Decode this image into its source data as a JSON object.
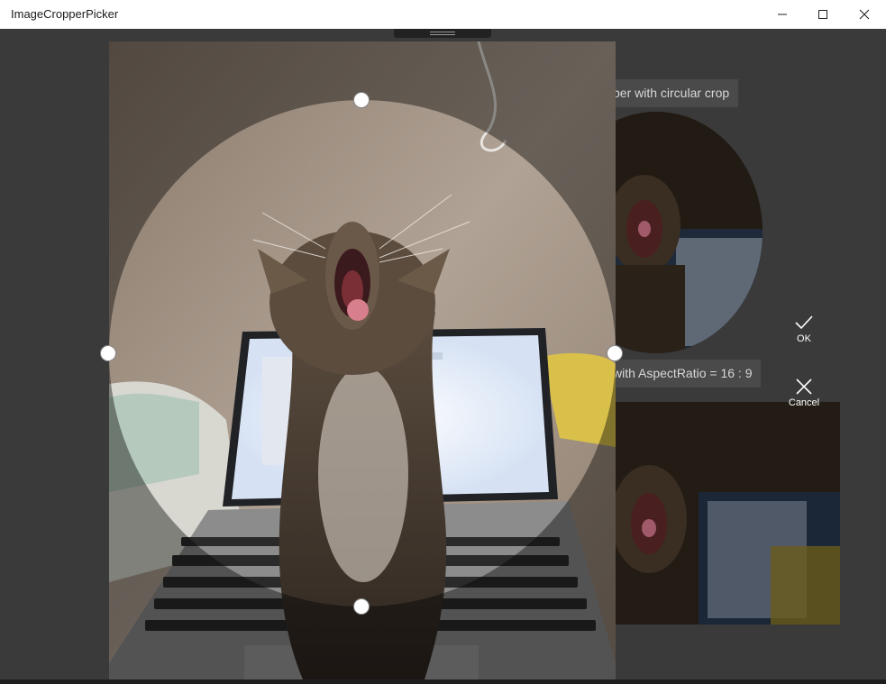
{
  "window": {
    "title": "ImageCropperPicker",
    "minimize_label": "minimize",
    "maximize_label": "maximize",
    "close_label": "close"
  },
  "background": {
    "circular_label": "per with circular crop",
    "aspect_label": "with AspectRatio = 16 : 9"
  },
  "actions": {
    "ok_label": "OK",
    "cancel_label": "Cancel"
  },
  "colors": {
    "overlay": "#000000",
    "handle": "#ffffff",
    "wall": "#a5968a",
    "laptop_screen": "#eef3fb"
  }
}
